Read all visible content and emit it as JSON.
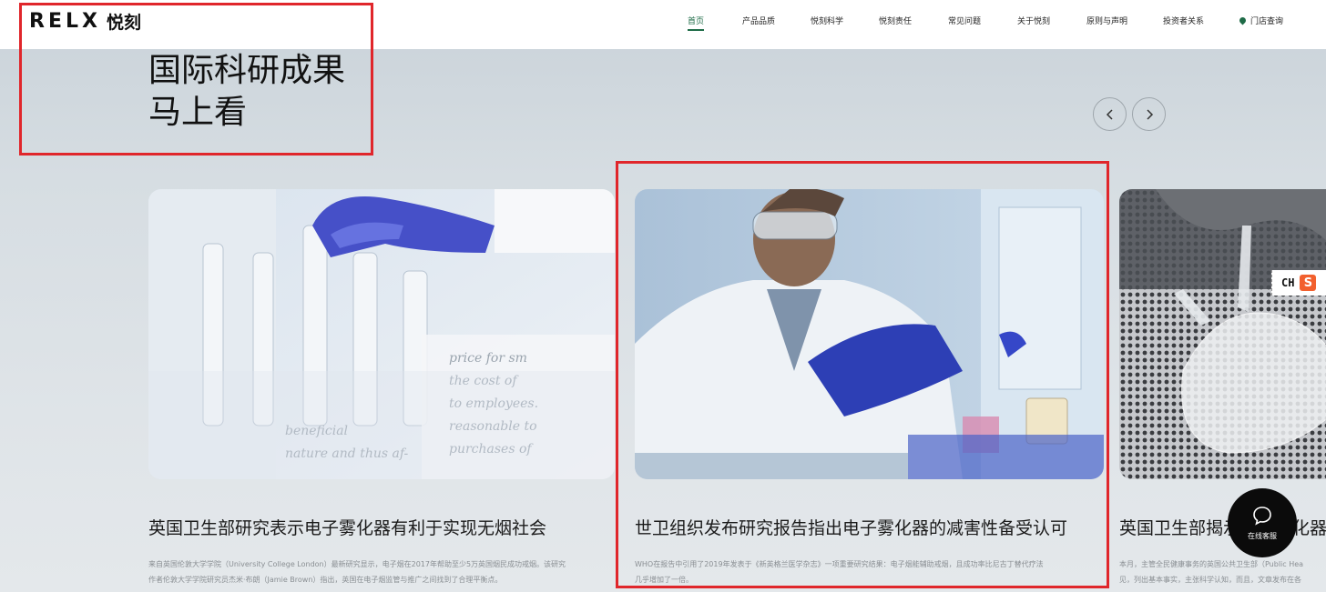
{
  "header": {
    "logo_latin": "RELX",
    "logo_cn": "悦刻",
    "nav": [
      {
        "label": "首页",
        "active": true
      },
      {
        "label": "产品品质"
      },
      {
        "label": "悦刻科学"
      },
      {
        "label": "悦刻责任"
      },
      {
        "label": "常见问题"
      },
      {
        "label": "关于悦刻"
      },
      {
        "label": "原则与声明"
      },
      {
        "label": "投资者关系"
      },
      {
        "label": "门店查询",
        "icon": "location-pin-icon"
      }
    ]
  },
  "hero": {
    "title_line1": "国际科研成果",
    "title_line2": "马上看"
  },
  "carousel": {
    "prev_icon": "chevron-left-icon",
    "next_icon": "chevron-right-icon"
  },
  "cards": [
    {
      "title": "英国卫生部研究表示电子雾化器有利于实现无烟社会",
      "desc_line1": "来自英国伦敦大学学院（University College London）最新研究显示，电子烟在2017年帮助至少5万英国烟民成功戒烟。该研究",
      "desc_line2": "作者伦敦大学学院研究员杰米·布朗（Jamie Brown）指出，英国在电子烟监管与推广之间找到了合理平衡点。",
      "image": "lab-glassware-photo"
    },
    {
      "title": "世卫组织发布研究报告指出电子雾化器的减害性备受认可",
      "desc_line1": "WHO在报告中引用了2019年发表于《新英格兰医学杂志》一项重要研究结果：电子烟能辅助戒烟，且成功率比尼古丁替代疗法",
      "desc_line2": "几乎增加了一倍。",
      "image": "scientist-lab-photo"
    },
    {
      "title": "英国卫生部揭示电子雾化器",
      "desc_line1": "本月，主管全民健康事务的英国公共卫生部（Public Hea",
      "desc_line2": "见，列出基本事实，主张科学认知，而且，文章发布在各",
      "image": "device-structure-photo"
    }
  ],
  "chat": {
    "label": "在线客服",
    "icon": "chat-bubble-icon"
  },
  "ime_widget": {
    "text": "CH",
    "badge": "S"
  },
  "colors": {
    "accent": "#1e6b47",
    "annotation": "#e0262b",
    "chat_bg": "#0b0b0b"
  }
}
